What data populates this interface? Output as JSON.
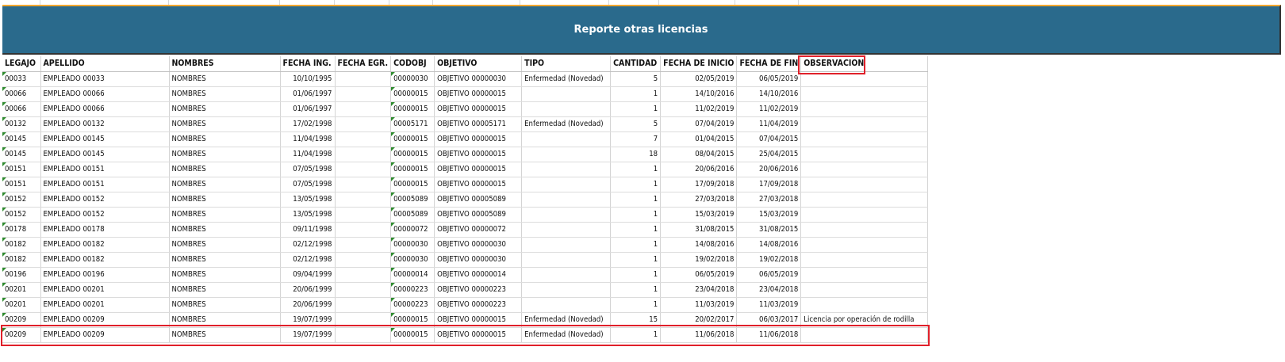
{
  "title": "Reporte otras licencias",
  "columns": [
    {
      "key": "legajo",
      "label": "LEGAJO"
    },
    {
      "key": "apellido",
      "label": "APELLIDO"
    },
    {
      "key": "nombres",
      "label": "NOMBRES"
    },
    {
      "key": "fecha_ing",
      "label": "FECHA ING."
    },
    {
      "key": "fecha_egr",
      "label": "FECHA EGR."
    },
    {
      "key": "codobj",
      "label": "CODOBJ"
    },
    {
      "key": "objetivo",
      "label": "OBJETIVO"
    },
    {
      "key": "tipo",
      "label": "TIPO"
    },
    {
      "key": "cantidad",
      "label": "CANTIDAD"
    },
    {
      "key": "fecha_inicio",
      "label": "FECHA DE INICIO"
    },
    {
      "key": "fecha_fin",
      "label": "FECHA DE FIN"
    },
    {
      "key": "observacion",
      "label": "OBSERVACION"
    }
  ],
  "rows": [
    {
      "legajo": "00033",
      "apellido": "EMPLEADO 00033",
      "nombres": "NOMBRES",
      "fecha_ing": "10/10/1995",
      "fecha_egr": "",
      "codobj": "00000030",
      "objetivo": "OBJETIVO 00000030",
      "tipo": "Enfermedad (Novedad)",
      "cantidad": "5",
      "fecha_inicio": "02/05/2019",
      "fecha_fin": "06/05/2019",
      "observacion": ""
    },
    {
      "legajo": "00066",
      "apellido": "EMPLEADO 00066",
      "nombres": "NOMBRES",
      "fecha_ing": "01/06/1997",
      "fecha_egr": "",
      "codobj": "00000015",
      "objetivo": "OBJETIVO 00000015",
      "tipo": "",
      "cantidad": "1",
      "fecha_inicio": "14/10/2016",
      "fecha_fin": "14/10/2016",
      "observacion": ""
    },
    {
      "legajo": "00066",
      "apellido": "EMPLEADO 00066",
      "nombres": "NOMBRES",
      "fecha_ing": "01/06/1997",
      "fecha_egr": "",
      "codobj": "00000015",
      "objetivo": "OBJETIVO 00000015",
      "tipo": "",
      "cantidad": "1",
      "fecha_inicio": "11/02/2019",
      "fecha_fin": "11/02/2019",
      "observacion": ""
    },
    {
      "legajo": "00132",
      "apellido": "EMPLEADO 00132",
      "nombres": "NOMBRES",
      "fecha_ing": "17/02/1998",
      "fecha_egr": "",
      "codobj": "00005171",
      "objetivo": "OBJETIVO 00005171",
      "tipo": "Enfermedad (Novedad)",
      "cantidad": "5",
      "fecha_inicio": "07/04/2019",
      "fecha_fin": "11/04/2019",
      "observacion": ""
    },
    {
      "legajo": "00145",
      "apellido": "EMPLEADO 00145",
      "nombres": "NOMBRES",
      "fecha_ing": "11/04/1998",
      "fecha_egr": "",
      "codobj": "00000015",
      "objetivo": "OBJETIVO 00000015",
      "tipo": "",
      "cantidad": "7",
      "fecha_inicio": "01/04/2015",
      "fecha_fin": "07/04/2015",
      "observacion": ""
    },
    {
      "legajo": "00145",
      "apellido": "EMPLEADO 00145",
      "nombres": "NOMBRES",
      "fecha_ing": "11/04/1998",
      "fecha_egr": "",
      "codobj": "00000015",
      "objetivo": "OBJETIVO 00000015",
      "tipo": "",
      "cantidad": "18",
      "fecha_inicio": "08/04/2015",
      "fecha_fin": "25/04/2015",
      "observacion": ""
    },
    {
      "legajo": "00151",
      "apellido": "EMPLEADO 00151",
      "nombres": "NOMBRES",
      "fecha_ing": "07/05/1998",
      "fecha_egr": "",
      "codobj": "00000015",
      "objetivo": "OBJETIVO 00000015",
      "tipo": "",
      "cantidad": "1",
      "fecha_inicio": "20/06/2016",
      "fecha_fin": "20/06/2016",
      "observacion": ""
    },
    {
      "legajo": "00151",
      "apellido": "EMPLEADO 00151",
      "nombres": "NOMBRES",
      "fecha_ing": "07/05/1998",
      "fecha_egr": "",
      "codobj": "00000015",
      "objetivo": "OBJETIVO 00000015",
      "tipo": "",
      "cantidad": "1",
      "fecha_inicio": "17/09/2018",
      "fecha_fin": "17/09/2018",
      "observacion": ""
    },
    {
      "legajo": "00152",
      "apellido": "EMPLEADO 00152",
      "nombres": "NOMBRES",
      "fecha_ing": "13/05/1998",
      "fecha_egr": "",
      "codobj": "00005089",
      "objetivo": "OBJETIVO 00005089",
      "tipo": "",
      "cantidad": "1",
      "fecha_inicio": "27/03/2018",
      "fecha_fin": "27/03/2018",
      "observacion": ""
    },
    {
      "legajo": "00152",
      "apellido": "EMPLEADO 00152",
      "nombres": "NOMBRES",
      "fecha_ing": "13/05/1998",
      "fecha_egr": "",
      "codobj": "00005089",
      "objetivo": "OBJETIVO 00005089",
      "tipo": "",
      "cantidad": "1",
      "fecha_inicio": "15/03/2019",
      "fecha_fin": "15/03/2019",
      "observacion": ""
    },
    {
      "legajo": "00178",
      "apellido": "EMPLEADO 00178",
      "nombres": "NOMBRES",
      "fecha_ing": "09/11/1998",
      "fecha_egr": "",
      "codobj": "00000072",
      "objetivo": "OBJETIVO 00000072",
      "tipo": "",
      "cantidad": "1",
      "fecha_inicio": "31/08/2015",
      "fecha_fin": "31/08/2015",
      "observacion": ""
    },
    {
      "legajo": "00182",
      "apellido": "EMPLEADO 00182",
      "nombres": "NOMBRES",
      "fecha_ing": "02/12/1998",
      "fecha_egr": "",
      "codobj": "00000030",
      "objetivo": "OBJETIVO 00000030",
      "tipo": "",
      "cantidad": "1",
      "fecha_inicio": "14/08/2016",
      "fecha_fin": "14/08/2016",
      "observacion": ""
    },
    {
      "legajo": "00182",
      "apellido": "EMPLEADO 00182",
      "nombres": "NOMBRES",
      "fecha_ing": "02/12/1998",
      "fecha_egr": "",
      "codobj": "00000030",
      "objetivo": "OBJETIVO 00000030",
      "tipo": "",
      "cantidad": "1",
      "fecha_inicio": "19/02/2018",
      "fecha_fin": "19/02/2018",
      "observacion": ""
    },
    {
      "legajo": "00196",
      "apellido": "EMPLEADO 00196",
      "nombres": "NOMBRES",
      "fecha_ing": "09/04/1999",
      "fecha_egr": "",
      "codobj": "00000014",
      "objetivo": "OBJETIVO 00000014",
      "tipo": "",
      "cantidad": "1",
      "fecha_inicio": "06/05/2019",
      "fecha_fin": "06/05/2019",
      "observacion": ""
    },
    {
      "legajo": "00201",
      "apellido": "EMPLEADO 00201",
      "nombres": "NOMBRES",
      "fecha_ing": "20/06/1999",
      "fecha_egr": "",
      "codobj": "00000223",
      "objetivo": "OBJETIVO 00000223",
      "tipo": "",
      "cantidad": "1",
      "fecha_inicio": "23/04/2018",
      "fecha_fin": "23/04/2018",
      "observacion": ""
    },
    {
      "legajo": "00201",
      "apellido": "EMPLEADO 00201",
      "nombres": "NOMBRES",
      "fecha_ing": "20/06/1999",
      "fecha_egr": "",
      "codobj": "00000223",
      "objetivo": "OBJETIVO 00000223",
      "tipo": "",
      "cantidad": "1",
      "fecha_inicio": "11/03/2019",
      "fecha_fin": "11/03/2019",
      "observacion": ""
    },
    {
      "legajo": "00209",
      "apellido": "EMPLEADO 00209",
      "nombres": "NOMBRES",
      "fecha_ing": "19/07/1999",
      "fecha_egr": "",
      "codobj": "00000015",
      "objetivo": "OBJETIVO 00000015",
      "tipo": "Enfermedad (Novedad)",
      "cantidad": "15",
      "fecha_inicio": "20/02/2017",
      "fecha_fin": "06/03/2017",
      "observacion": "Licencia por operación de rodilla"
    },
    {
      "legajo": "00209",
      "apellido": "EMPLEADO 00209",
      "nombres": "NOMBRES",
      "fecha_ing": "19/07/1999",
      "fecha_egr": "",
      "codobj": "00000015",
      "objetivo": "OBJETIVO 00000015",
      "tipo": "Enfermedad (Novedad)",
      "cantidad": "1",
      "fecha_inicio": "11/06/2018",
      "fecha_fin": "11/06/2018",
      "observacion": ""
    }
  ],
  "colors": {
    "title_band": "#2a6a8c",
    "highlight": "#e0202a",
    "indicator": "#2e8b2e"
  }
}
